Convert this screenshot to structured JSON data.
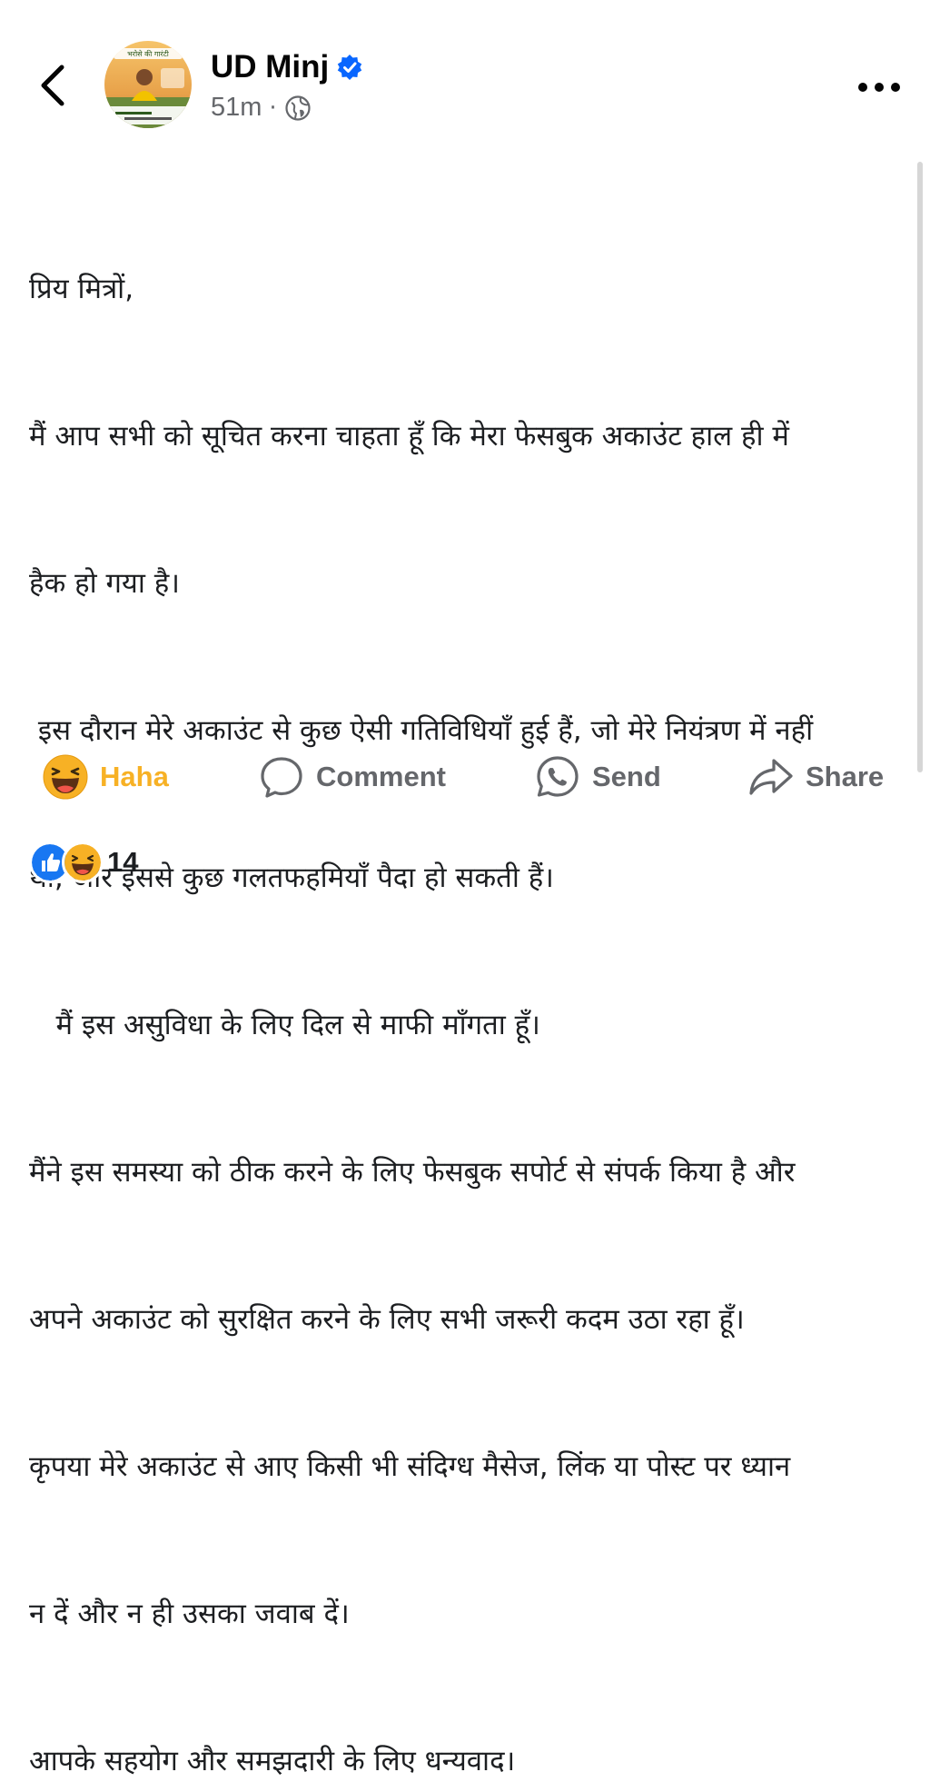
{
  "header": {
    "author_name": "UD Minj",
    "time": "51m",
    "separator": "·",
    "avatar_caption": "भरोसे की गारंटी"
  },
  "post": {
    "lines": [
      "प्रिय मित्रों,",
      "मैं आप सभी को सूचित करना चाहता हूँ कि मेरा फेसबुक अकाउंट हाल ही में",
      "हैक हो गया है।",
      " इस दौरान मेरे अकाउंट से कुछ ऐसी गतिविधियाँ हुई हैं, जो मेरे नियंत्रण में नहीं",
      "थीं, और इससे कुछ गलतफहमियाँ पैदा हो सकती हैं।",
      "   मैं इस असुविधा के लिए दिल से माफी माँगता हूँ।",
      "मैंने इस समस्या को ठीक करने के लिए फेसबुक सपोर्ट से संपर्क किया है और",
      "अपने अकाउंट को सुरक्षित करने के लिए सभी जरूरी कदम उठा रहा हूँ।",
      "कृपया मेरे अकाउंट से आए किसी भी संदिग्ध मैसेज, लिंक या पोस्ट पर ध्यान",
      "न दें और न ही उसका जवाब दें।",
      "आपके सहयोग और समझदारी के लिए धन्यवाद।"
    ]
  },
  "actions": {
    "haha_label": "Haha",
    "comment_label": "Comment",
    "send_label": "Send",
    "share_label": "Share"
  },
  "reactions": {
    "count": "14"
  },
  "colors": {
    "verified": "#0866ff",
    "haha": "#f7b125",
    "like": "#1877f2",
    "muted": "#65676b"
  }
}
